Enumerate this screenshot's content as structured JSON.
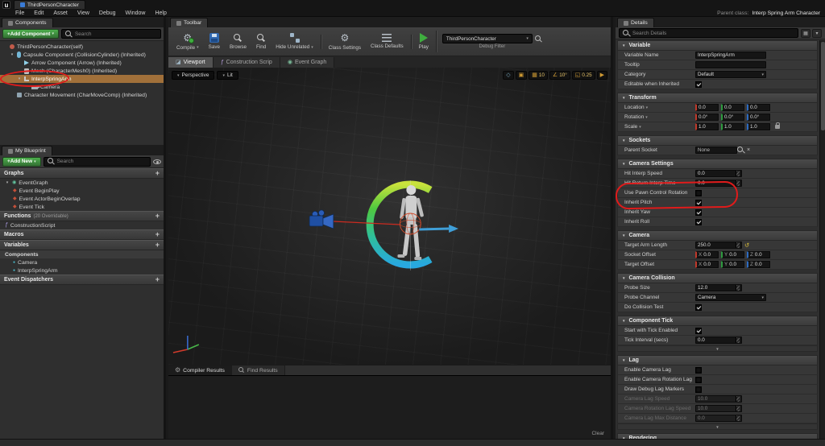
{
  "accent_colors": {
    "selection": "#a1703a",
    "annotation": "#e01b1b",
    "add_button_green": "#3f9b41",
    "snap_orange": "#cf9a33"
  },
  "titlebar": {
    "logo_glyph": "u",
    "window_tab": "ThirdPersonCharacter",
    "menus": [
      "File",
      "Edit",
      "Asset",
      "View",
      "Debug",
      "Window",
      "Help"
    ],
    "parent_class_label": "Parent class:",
    "parent_class_value": "Interp Spring Arm Character"
  },
  "components_panel": {
    "tab": "Components",
    "add_button": "+Add Component",
    "search_placeholder": "Search",
    "tree": [
      {
        "label": "ThirdPersonCharacter(self)",
        "indent": 0,
        "icon": "actor-icon"
      },
      {
        "label": "Capsule Component (CollisionCylinder) (Inherited)",
        "indent": 1,
        "icon": "capsule-icon",
        "expander": true
      },
      {
        "label": "Arrow Component (Arrow) (Inherited)",
        "indent": 2,
        "icon": "arrow-icon"
      },
      {
        "label": "Mesh (CharacterMesh0) (Inherited)",
        "indent": 2,
        "icon": "mesh-icon"
      },
      {
        "label": "InterpSpringArm",
        "indent": 2,
        "icon": "springarm-icon",
        "expander": true,
        "selected": true
      },
      {
        "label": "Camera",
        "indent": 3,
        "icon": "camera-icon"
      },
      {
        "label": "Character Movement (CharMoveComp) (Inherited)",
        "indent": 1,
        "icon": "movement-icon"
      }
    ]
  },
  "my_blueprint_panel": {
    "tab": "My Blueprint",
    "add_button": "+Add New",
    "search_placeholder": "Search",
    "sections": [
      {
        "title": "Graphs",
        "items": [
          {
            "label": "EventGraph",
            "indent": 0,
            "icon": "graph-icon",
            "expander": true
          },
          {
            "label": "Event BeginPlay",
            "indent": 1,
            "icon": "event-icon"
          },
          {
            "label": "Event ActorBeginOverlap",
            "indent": 1,
            "icon": "event-icon"
          },
          {
            "label": "Event Tick",
            "indent": 1,
            "icon": "event-icon"
          }
        ]
      },
      {
        "title": "Functions",
        "subtitle": "(20 Overridable)",
        "items": [
          {
            "label": "ConstructionScript",
            "indent": 0,
            "icon": "function-icon"
          }
        ]
      },
      {
        "title": "Macros",
        "items": []
      },
      {
        "title": "Variables",
        "items": [
          {
            "label": "Components",
            "indent": 0,
            "icon": "category-icon",
            "category": true
          },
          {
            "label": "Camera",
            "indent": 1,
            "icon": "component-icon"
          },
          {
            "label": "InterpSpringArm",
            "indent": 1,
            "icon": "component-icon"
          }
        ]
      },
      {
        "title": "Event Dispatchers",
        "items": []
      }
    ]
  },
  "toolbar_panel": {
    "tab": "Toolbar",
    "buttons": [
      {
        "label": "Compile",
        "icon": "compile-icon",
        "group": 1,
        "dropdown": true
      },
      {
        "label": "Save",
        "icon": "save-icon",
        "group": 1
      },
      {
        "label": "Browse",
        "icon": "browse-icon",
        "group": 1
      },
      {
        "label": "Find",
        "icon": "find-icon",
        "group": 1
      },
      {
        "label": "Hide Unrelated",
        "icon": "hide-unrelated-icon",
        "group": 1,
        "dropdown": true
      },
      {
        "label": "Class Settings",
        "icon": "class-settings-icon",
        "group": 2
      },
      {
        "label": "Class Defaults",
        "icon": "class-defaults-icon",
        "group": 2
      },
      {
        "label": "Play",
        "icon": "play-icon",
        "group": 3
      }
    ],
    "debug_object": "ThirdPersonCharacter",
    "debug_filter_label": "Debug Filter"
  },
  "doc_tabs": [
    {
      "label": "Viewport",
      "icon": "viewport-icon",
      "selected": true
    },
    {
      "label": "Construction Scrip",
      "icon": "function-icon"
    },
    {
      "label": "Event Graph",
      "icon": "graph-icon"
    }
  ],
  "viewport": {
    "perspective_button": "Perspective",
    "lit_button": "Lit",
    "snap_controls": [
      {
        "name": "viewport-options-icon",
        "glyph": "◇"
      },
      {
        "name": "surface-snap-icon",
        "glyph": "▣"
      },
      {
        "name": "grid-snap-icon",
        "glyph": "▦",
        "value": "10"
      },
      {
        "name": "rotation-snap-icon",
        "glyph": "∠",
        "value": "10°"
      },
      {
        "name": "scale-snap-icon",
        "glyph": "◱",
        "value": "0.25"
      },
      {
        "name": "camera-speed-icon",
        "glyph": "▶"
      }
    ]
  },
  "bottom_tabs": [
    {
      "label": "Compiler Results",
      "icon": "compiler-icon",
      "selected": true
    },
    {
      "label": "Find Results",
      "icon": "find-icon"
    }
  ],
  "output_panel": {
    "clear_button": "Clear"
  },
  "details_panel": {
    "tab": "Details",
    "search_placeholder": "Search Details",
    "axes": [
      "X",
      "Y",
      "Z"
    ],
    "header_icons": [
      {
        "name": "property-matrix-icon",
        "glyph": "▦"
      },
      {
        "name": "display-options-icon",
        "glyph": "▾"
      }
    ],
    "sections": [
      {
        "title": "Variable",
        "rows": [
          {
            "label": "Variable Name",
            "type": "text",
            "value": "InterpSpringArm"
          },
          {
            "label": "Tooltip",
            "type": "text",
            "value": ""
          },
          {
            "label": "Category",
            "type": "dropdown",
            "value": "Default"
          },
          {
            "label": "Editable when Inherited",
            "type": "checkbox",
            "checked": true
          }
        ]
      },
      {
        "title": "Transform",
        "rows": [
          {
            "label": "Location",
            "type": "vector",
            "values": [
              "0.0",
              "0.0",
              "0.0"
            ],
            "label_dropdown": true
          },
          {
            "label": "Rotation",
            "type": "vector",
            "values": [
              "0.0°",
              "0.0°",
              "0.0°"
            ],
            "label_dropdown": true
          },
          {
            "label": "Scale",
            "type": "vector",
            "values": [
              "1.0",
              "1.0",
              "1.0"
            ],
            "label_dropdown": true,
            "lock": true
          }
        ]
      },
      {
        "title": "Sockets",
        "rows": [
          {
            "label": "Parent Socket",
            "type": "socket",
            "value": "None"
          }
        ]
      },
      {
        "title": "Camera Settings",
        "rows": [
          {
            "label": "Hit Interp Speed",
            "type": "number",
            "value": "0.0",
            "highlight": true
          },
          {
            "label": "Hit Return Interp Time",
            "type": "number",
            "value": "0.0",
            "highlight": true
          },
          {
            "label": "Use Pawn Control Rotation",
            "type": "checkbox",
            "checked": false
          },
          {
            "label": "Inherit Pitch",
            "type": "checkbox",
            "checked": true
          },
          {
            "label": "Inherit Yaw",
            "type": "checkbox",
            "checked": true
          },
          {
            "label": "Inherit Roll",
            "type": "checkbox",
            "checked": true
          }
        ]
      },
      {
        "title": "Camera",
        "rows": [
          {
            "label": "Target Arm Length",
            "type": "number",
            "value": "250.0",
            "reset": true
          },
          {
            "label": "Socket Offset",
            "type": "xyz",
            "values": [
              "0.0",
              "0.0",
              "0.0"
            ]
          },
          {
            "label": "Target Offset",
            "type": "xyz",
            "values": [
              "0.0",
              "0.0",
              "0.0"
            ]
          }
        ]
      },
      {
        "title": "Camera Collision",
        "rows": [
          {
            "label": "Probe Size",
            "type": "number",
            "value": "12.0"
          },
          {
            "label": "Probe Channel",
            "type": "dropdown",
            "value": "Camera"
          },
          {
            "label": "Do Collision Test",
            "type": "checkbox",
            "checked": true
          }
        ]
      },
      {
        "title": "Component Tick",
        "expander": true,
        "rows": [
          {
            "label": "Start with Tick Enabled",
            "type": "checkbox",
            "checked": true
          },
          {
            "label": "Tick Interval (secs)",
            "type": "number",
            "value": "0.0"
          }
        ]
      },
      {
        "title": "Lag",
        "expander": true,
        "rows": [
          {
            "label": "Enable Camera Lag",
            "type": "checkbox",
            "checked": false
          },
          {
            "label": "Enable Camera Rotation Lag",
            "type": "checkbox",
            "checked": false
          },
          {
            "label": "Draw Debug Lag Markers",
            "type": "checkbox",
            "checked": false
          },
          {
            "label": "Camera Lag Speed",
            "type": "number",
            "value": "10.0",
            "disabled": true
          },
          {
            "label": "Camera Rotation Lag Speed",
            "type": "number",
            "value": "10.0",
            "disabled": true
          },
          {
            "label": "Camera Lag Max Distance",
            "type": "number",
            "value": "0.0",
            "disabled": true
          }
        ]
      },
      {
        "title": "Rendering",
        "rows": []
      }
    ]
  }
}
